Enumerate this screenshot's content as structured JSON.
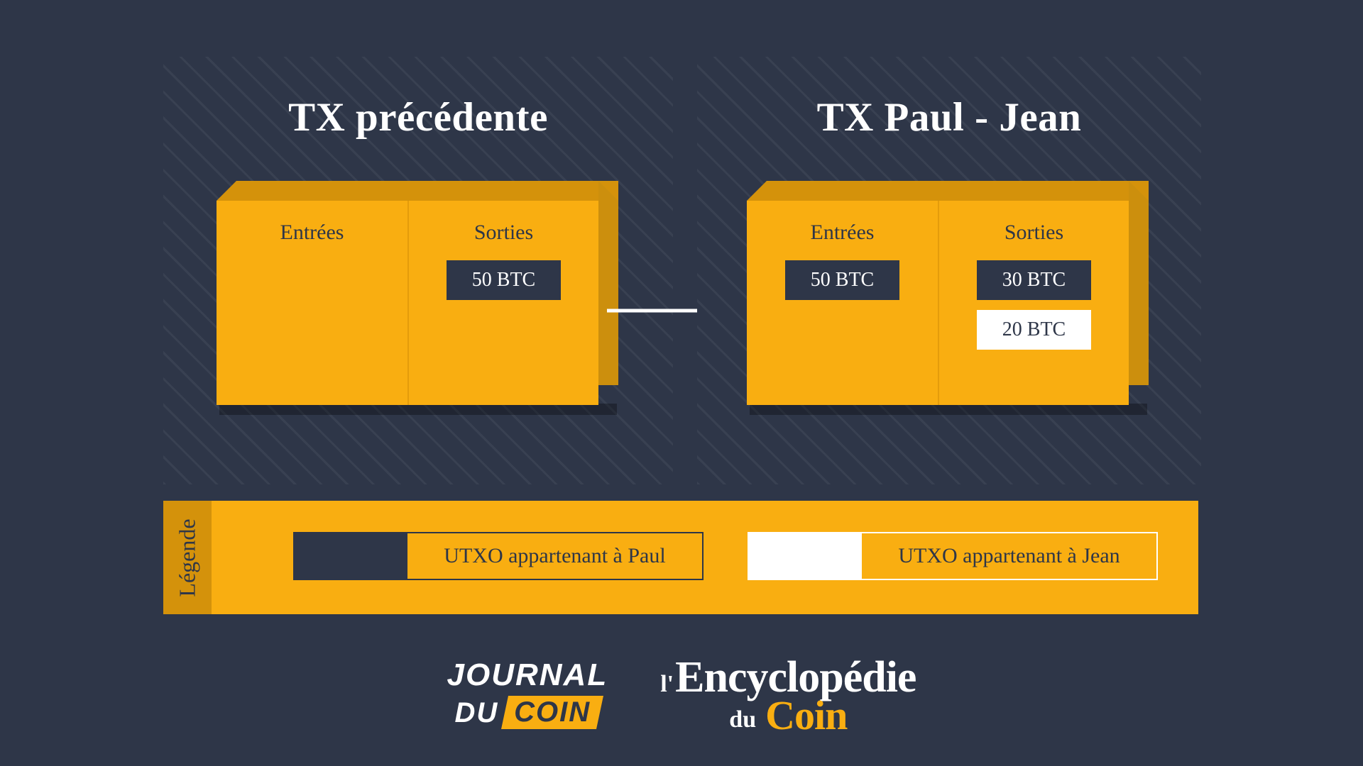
{
  "colors": {
    "background": "#2e3648",
    "orange": "#f9ae11",
    "orange_dark": "#d4920b",
    "orange_side": "#cc8f0d",
    "white": "#ffffff",
    "navy": "#2e3648"
  },
  "transactions": [
    {
      "title": "TX précédente",
      "columns": [
        {
          "heading": "Entrées",
          "utxos": []
        },
        {
          "heading": "Sorties",
          "utxos": [
            {
              "amount": "50 BTC",
              "owner": "paul"
            }
          ]
        }
      ]
    },
    {
      "title": "TX Paul - Jean",
      "columns": [
        {
          "heading": "Entrées",
          "utxos": [
            {
              "amount": "50 BTC",
              "owner": "paul"
            }
          ]
        },
        {
          "heading": "Sorties",
          "utxos": [
            {
              "amount": "30 BTC",
              "owner": "paul"
            },
            {
              "amount": "20 BTC",
              "owner": "jean"
            }
          ]
        }
      ]
    }
  ],
  "arrow": {
    "icon": "arrow-right-icon",
    "color": "#ffffff"
  },
  "legend": {
    "label": "Légende",
    "entries": [
      {
        "swatch": "paul",
        "text": "UTXO appartenant à Paul"
      },
      {
        "swatch": "jean",
        "text": "UTXO appartenant à Jean"
      }
    ]
  },
  "footer": {
    "journal_du_coin": {
      "line1": "JOURNAL",
      "line2_a": "DU",
      "line2_b": "COIN"
    },
    "encyclopedie": {
      "prefix": "l'",
      "main": "Encyclopédie",
      "du": "du",
      "coin": "Coin"
    }
  }
}
